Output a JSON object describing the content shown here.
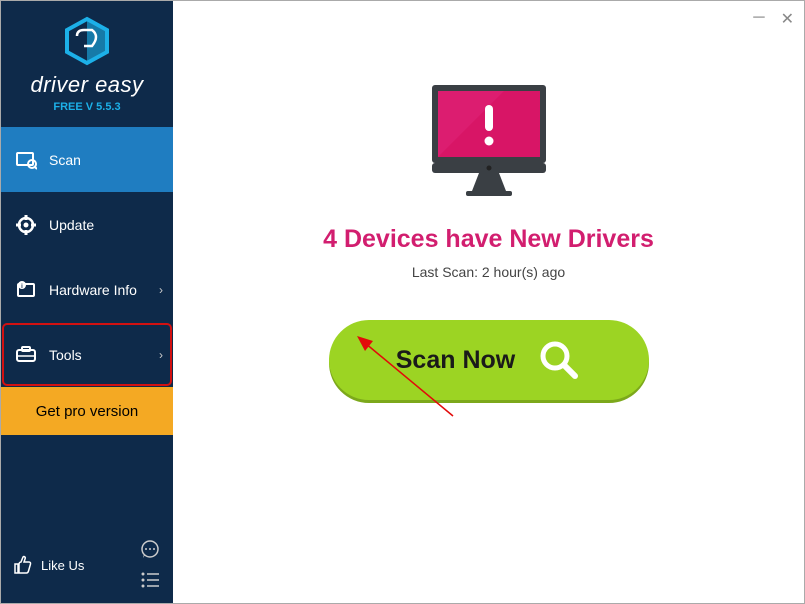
{
  "brand": {
    "name": "driver easy",
    "version": "FREE V 5.5.3"
  },
  "sidebar": {
    "items": [
      {
        "label": "Scan"
      },
      {
        "label": "Update"
      },
      {
        "label": "Hardware Info"
      },
      {
        "label": "Tools"
      }
    ],
    "getPro": "Get pro version",
    "likeUs": "Like Us"
  },
  "main": {
    "headline": "4 Devices have New Drivers",
    "lastScan": "Last Scan: 2 hour(s) ago",
    "scanButton": "Scan Now"
  },
  "colors": {
    "accent": "#d21e6f",
    "scan": "#9cd423",
    "sidebar": "#0e2a4a"
  }
}
